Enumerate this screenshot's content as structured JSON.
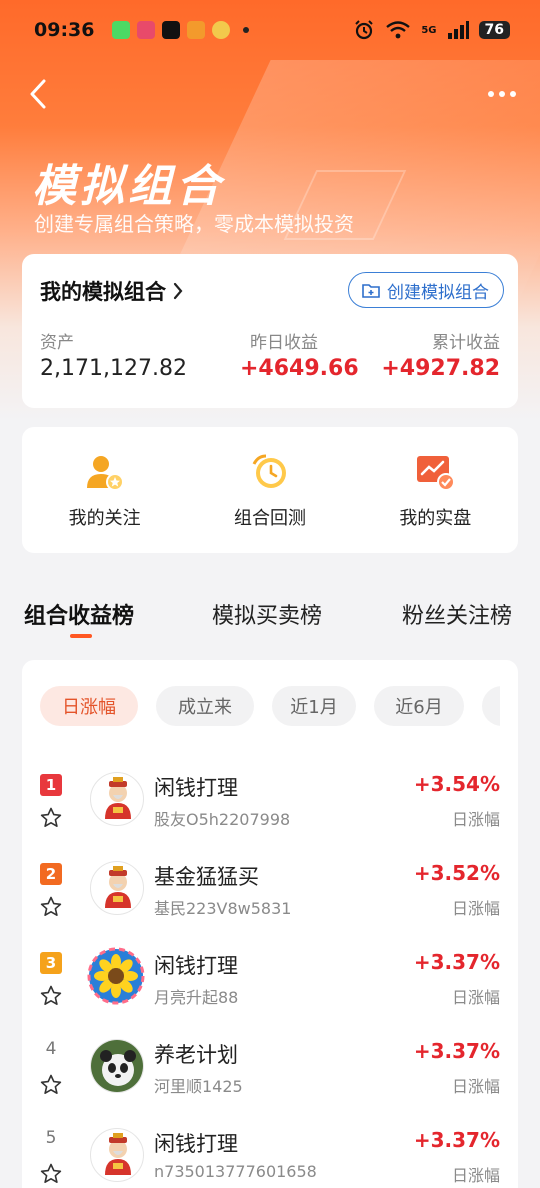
{
  "status_bar": {
    "time": "09:36",
    "battery": "76",
    "signal_label": "5G"
  },
  "header": {
    "title": "模拟组合",
    "subtitle": "创建专属组合策略，零成本模拟投资"
  },
  "portfolio": {
    "title": "我的模拟组合",
    "create_label": "创建模拟组合",
    "stats": [
      {
        "label": "资产",
        "value": "2,171,127.82"
      },
      {
        "label": "昨日收益",
        "value": "+4649.66"
      },
      {
        "label": "累计收益",
        "value": "+4927.82"
      }
    ]
  },
  "shortcuts": [
    {
      "label": "我的关注",
      "icon": "user-star-icon"
    },
    {
      "label": "组合回测",
      "icon": "clock-icon"
    },
    {
      "label": "我的实盘",
      "icon": "chart-check-icon"
    }
  ],
  "tabs": [
    {
      "label": "组合收益榜",
      "active": true
    },
    {
      "label": "模拟买卖榜",
      "active": false
    },
    {
      "label": "粉丝关注榜",
      "active": false
    }
  ],
  "filters": [
    {
      "label": "日涨幅",
      "active": true
    },
    {
      "label": "成立来",
      "active": false
    },
    {
      "label": "近1月",
      "active": false
    },
    {
      "label": "近6月",
      "active": false
    }
  ],
  "rankings": [
    {
      "rank": "1",
      "name": "闲钱打理",
      "user": "股友O5h2207998",
      "pct": "+3.54%",
      "pct_label": "日涨幅",
      "avatar": "fortune-god-avatar"
    },
    {
      "rank": "2",
      "name": "基金猛猛买",
      "user": "基民223V8w5831",
      "pct": "+3.52%",
      "pct_label": "日涨幅",
      "avatar": "fortune-god-avatar"
    },
    {
      "rank": "3",
      "name": "闲钱打理",
      "user": "月亮升起88",
      "pct": "+3.37%",
      "pct_label": "日涨幅",
      "avatar": "sunflower-avatar"
    },
    {
      "rank": "4",
      "name": "养老计划",
      "user": "河里顺1425",
      "pct": "+3.37%",
      "pct_label": "日涨幅",
      "avatar": "panda-avatar"
    },
    {
      "rank": "5",
      "name": "闲钱打理",
      "user": "n735013777601658",
      "pct": "+3.37%",
      "pct_label": "日涨幅",
      "avatar": "fortune-god-avatar"
    }
  ],
  "colors": {
    "brand_orange": "#ff6a2a",
    "up_red": "#e4262d",
    "link_blue": "#2e6fcc",
    "rank1": "#e8383d",
    "rank2": "#f26a21",
    "rank3": "#f5a21b"
  }
}
